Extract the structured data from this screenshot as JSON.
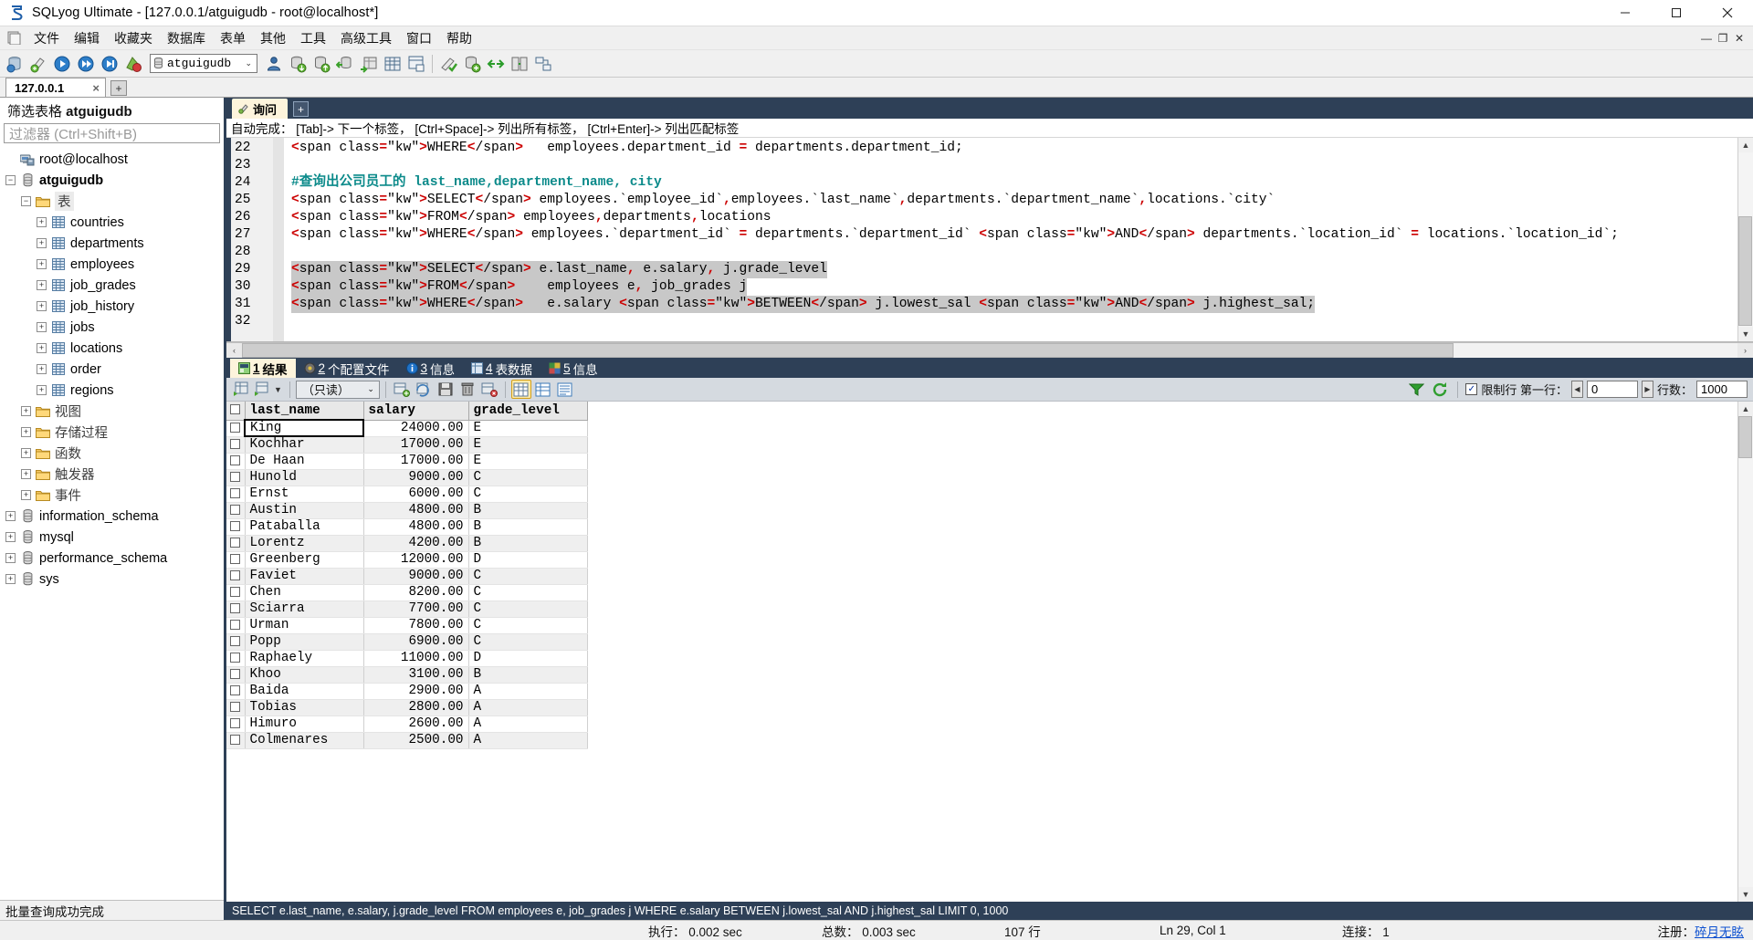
{
  "window": {
    "title": "SQLyog Ultimate - [127.0.0.1/atguigudb - root@localhost*]",
    "minimize": "—",
    "maximize": "❐",
    "close": "✕"
  },
  "menubar": {
    "items": [
      {
        "label": "文件",
        "name": "menu-file"
      },
      {
        "label": "编辑",
        "name": "menu-edit"
      },
      {
        "label": "收藏夹",
        "name": "menu-favorites"
      },
      {
        "label": "数据库",
        "name": "menu-database"
      },
      {
        "label": "表单",
        "name": "menu-table"
      },
      {
        "label": "其他",
        "name": "menu-other"
      },
      {
        "label": "工具",
        "name": "menu-tools"
      },
      {
        "label": "高级工具",
        "name": "menu-advanced-tools"
      },
      {
        "label": "窗口",
        "name": "menu-window"
      },
      {
        "label": "帮助",
        "name": "menu-help"
      }
    ],
    "mdi_minimize": "—",
    "mdi_restore": "❐",
    "mdi_close": "✕"
  },
  "toolbar": {
    "database_value": "atguigudb",
    "dropdown_arrow": "⌄",
    "icons": [
      "new-connection-icon",
      "new-query-icon",
      "execute-icon",
      "execute-all-icon",
      "execute-query-icon",
      "stop-icon"
    ]
  },
  "connection_tabs": {
    "tabs": [
      {
        "label": "127.0.0.1",
        "close": "×"
      }
    ],
    "add_label": "+"
  },
  "sidebar": {
    "filter_title_prefix": "筛选表格 ",
    "filter_title_db": "atguigudb",
    "filter_placeholder": "过滤器 (Ctrl+Shift+B)",
    "tree": [
      {
        "label": "root@localhost",
        "level": 0,
        "icon": "server-icon",
        "expander": "",
        "bold": false
      },
      {
        "label": "atguigudb",
        "level": 0,
        "icon": "db-icon",
        "expander": "−",
        "bold": true
      },
      {
        "label": "表",
        "level": 1,
        "icon": "folder-icon",
        "expander": "−",
        "bold": false,
        "selected": true
      },
      {
        "label": "countries",
        "level": 2,
        "icon": "table-icon",
        "expander": "+",
        "bold": false
      },
      {
        "label": "departments",
        "level": 2,
        "icon": "table-icon",
        "expander": "+",
        "bold": false
      },
      {
        "label": "employees",
        "level": 2,
        "icon": "table-icon",
        "expander": "+",
        "bold": false
      },
      {
        "label": "job_grades",
        "level": 2,
        "icon": "table-icon",
        "expander": "+",
        "bold": false
      },
      {
        "label": "job_history",
        "level": 2,
        "icon": "table-icon",
        "expander": "+",
        "bold": false
      },
      {
        "label": "jobs",
        "level": 2,
        "icon": "table-icon",
        "expander": "+",
        "bold": false
      },
      {
        "label": "locations",
        "level": 2,
        "icon": "table-icon",
        "expander": "+",
        "bold": false
      },
      {
        "label": "order",
        "level": 2,
        "icon": "table-icon",
        "expander": "+",
        "bold": false
      },
      {
        "label": "regions",
        "level": 2,
        "icon": "table-icon",
        "expander": "+",
        "bold": false
      },
      {
        "label": "视图",
        "level": 1,
        "icon": "folder-icon",
        "expander": "+",
        "bold": false
      },
      {
        "label": "存储过程",
        "level": 1,
        "icon": "folder-icon",
        "expander": "+",
        "bold": false
      },
      {
        "label": "函数",
        "level": 1,
        "icon": "folder-icon",
        "expander": "+",
        "bold": false
      },
      {
        "label": "触发器",
        "level": 1,
        "icon": "folder-icon",
        "expander": "+",
        "bold": false
      },
      {
        "label": "事件",
        "level": 1,
        "icon": "folder-icon",
        "expander": "+",
        "bold": false
      },
      {
        "label": "information_schema",
        "level": 0,
        "icon": "db-icon",
        "expander": "+",
        "bold": false
      },
      {
        "label": "mysql",
        "level": 0,
        "icon": "db-icon",
        "expander": "+",
        "bold": false
      },
      {
        "label": "performance_schema",
        "level": 0,
        "icon": "db-icon",
        "expander": "+",
        "bold": false
      },
      {
        "label": "sys",
        "level": 0,
        "icon": "db-icon",
        "expander": "+",
        "bold": false
      }
    ]
  },
  "editor": {
    "tab_label": "询问",
    "add_label": "+",
    "autocomplete_text": "自动完成： [Tab]-> 下一个标签， [Ctrl+Space]-> 列出所有标签， [Ctrl+Enter]-> 列出匹配标签",
    "first_line_number": 22,
    "lines": [
      {
        "n": 22,
        "text": "WHERE   employees.department_id = departments.department_id;",
        "selected": false
      },
      {
        "n": 23,
        "text": "",
        "selected": false
      },
      {
        "n": 24,
        "text": "#查询出公司员工的 last_name,department_name, city",
        "selected": false
      },
      {
        "n": 25,
        "text": "SELECT employees.`employee_id`,employees.`last_name`,departments.`department_name`,locations.`city`",
        "selected": false
      },
      {
        "n": 26,
        "text": "FROM employees,departments,locations",
        "selected": false
      },
      {
        "n": 27,
        "text": "WHERE employees.`department_id` = departments.`department_id` AND departments.`location_id` = locations.`location_id`;",
        "selected": false
      },
      {
        "n": 28,
        "text": "",
        "selected": false
      },
      {
        "n": 29,
        "text": "SELECT e.last_name, e.salary, j.grade_level",
        "selected": true
      },
      {
        "n": 30,
        "text": "FROM    employees e, job_grades j",
        "selected": true
      },
      {
        "n": 31,
        "text": "WHERE   e.salary BETWEEN j.lowest_sal AND j.highest_sal;",
        "selected": true
      },
      {
        "n": 32,
        "text": "",
        "selected": false
      }
    ],
    "scroll_left_arrow": "‹",
    "scroll_right_arrow": "›"
  },
  "results": {
    "tabs": [
      {
        "num": "1",
        "label": "结果",
        "icon": "result-grid-icon",
        "active": true
      },
      {
        "num": "2",
        "label": "个配置文件",
        "icon": "profile-icon",
        "active": false
      },
      {
        "num": "3",
        "label": "信息",
        "icon": "info-icon",
        "active": false
      },
      {
        "num": "4",
        "label": "表数据",
        "icon": "table-data-icon",
        "active": false
      },
      {
        "num": "5",
        "label": "信息",
        "icon": "objects-icon",
        "active": false
      }
    ],
    "toolbar": {
      "readonly_label": "（只读）",
      "dropdown_arrow": "⌄",
      "limit_checkbox_label": "限制行 第一行：",
      "limit_checked": true,
      "offset_value": "0",
      "rows_label": "行数：",
      "rows_value": "1000",
      "prev_arrow": "◀",
      "next_arrow": "▶"
    },
    "columns": [
      "last_name",
      "salary",
      "grade_level"
    ],
    "rows": [
      [
        "King",
        "24000.00",
        "E"
      ],
      [
        "Kochhar",
        "17000.00",
        "E"
      ],
      [
        "De Haan",
        "17000.00",
        "E"
      ],
      [
        "Hunold",
        "9000.00",
        "C"
      ],
      [
        "Ernst",
        "6000.00",
        "C"
      ],
      [
        "Austin",
        "4800.00",
        "B"
      ],
      [
        "Pataballa",
        "4800.00",
        "B"
      ],
      [
        "Lorentz",
        "4200.00",
        "B"
      ],
      [
        "Greenberg",
        "12000.00",
        "D"
      ],
      [
        "Faviet",
        "9000.00",
        "C"
      ],
      [
        "Chen",
        "8200.00",
        "C"
      ],
      [
        "Sciarra",
        "7700.00",
        "C"
      ],
      [
        "Urman",
        "7800.00",
        "C"
      ],
      [
        "Popp",
        "6900.00",
        "C"
      ],
      [
        "Raphaely",
        "11000.00",
        "D"
      ],
      [
        "Khoo",
        "3100.00",
        "B"
      ],
      [
        "Baida",
        "2900.00",
        "A"
      ],
      [
        "Tobias",
        "2800.00",
        "A"
      ],
      [
        "Himuro",
        "2600.00",
        "A"
      ],
      [
        "Colmenares",
        "2500.00",
        "A"
      ]
    ],
    "selected_cell": {
      "row": 0,
      "col": 0
    },
    "sql_footer": "SELECT e.last_name, e.salary, j.grade_level FROM employees e, job_grades j WHERE e.salary BETWEEN j.lowest_sal AND j.highest_sal LIMIT 0, 1000"
  },
  "statusbar": {
    "left_message": "批量查询成功完成",
    "exec_time": "执行：  0.002 sec",
    "total_time": "总数：  0.003 sec",
    "row_count": "107 行",
    "cursor_pos": "Ln 29, Col 1",
    "connection": "连接：  1",
    "register_prefix": "注册： ",
    "register_link": "碎月无眩"
  },
  "colors": {
    "accent_dark": "#2e4057",
    "tab_active": "#fdf4dc",
    "keyword": "#3333cc",
    "operator": "#cc0000",
    "comment": "#0b8a8a",
    "selection": "#c8c8c8"
  }
}
